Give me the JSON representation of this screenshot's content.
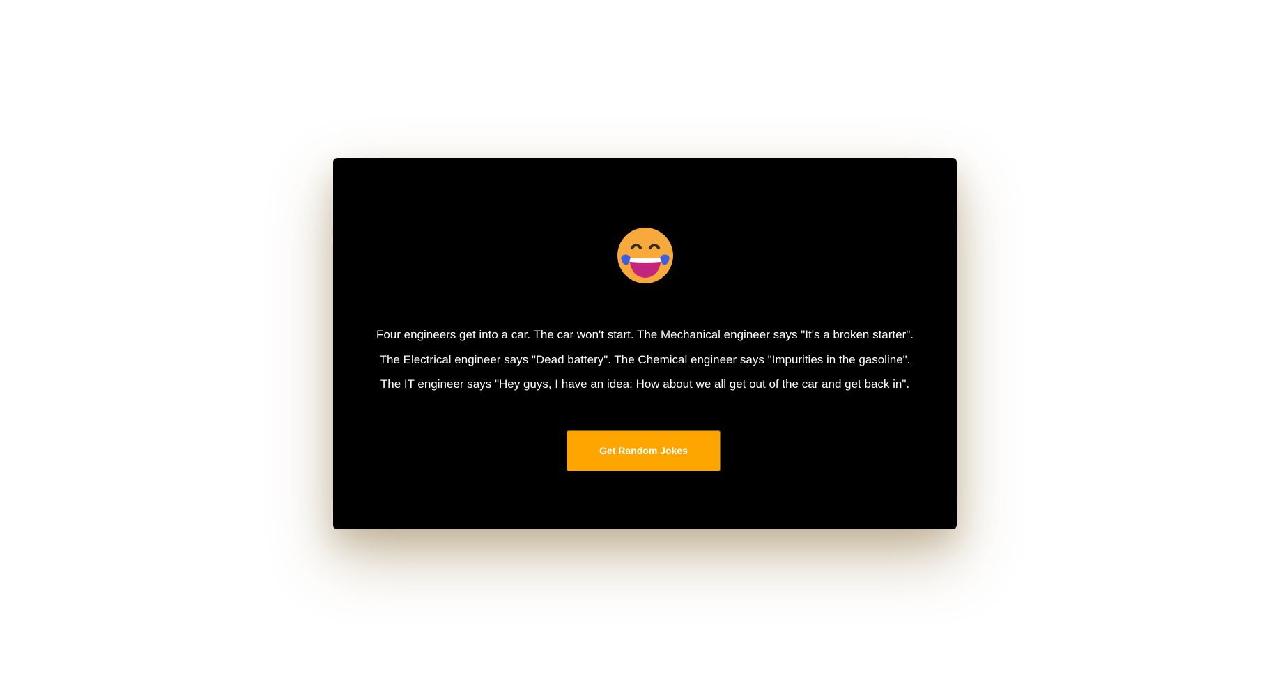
{
  "emoji": {
    "icon": "face-with-tears-of-joy-icon"
  },
  "joke": {
    "text": "Four engineers get into a car. The car won't start. The Mechanical engineer says \"It's a broken starter\". The Electrical engineer says \"Dead battery\". The Chemical engineer says \"Impurities in the gasoline\". The IT engineer says \"Hey guys, I have an idea: How about we all get out of the car and get back in\"."
  },
  "button": {
    "label": "Get Random Jokes"
  },
  "colors": {
    "card_background": "#000000",
    "button_background": "#ffa500",
    "text": "#ffffff"
  }
}
